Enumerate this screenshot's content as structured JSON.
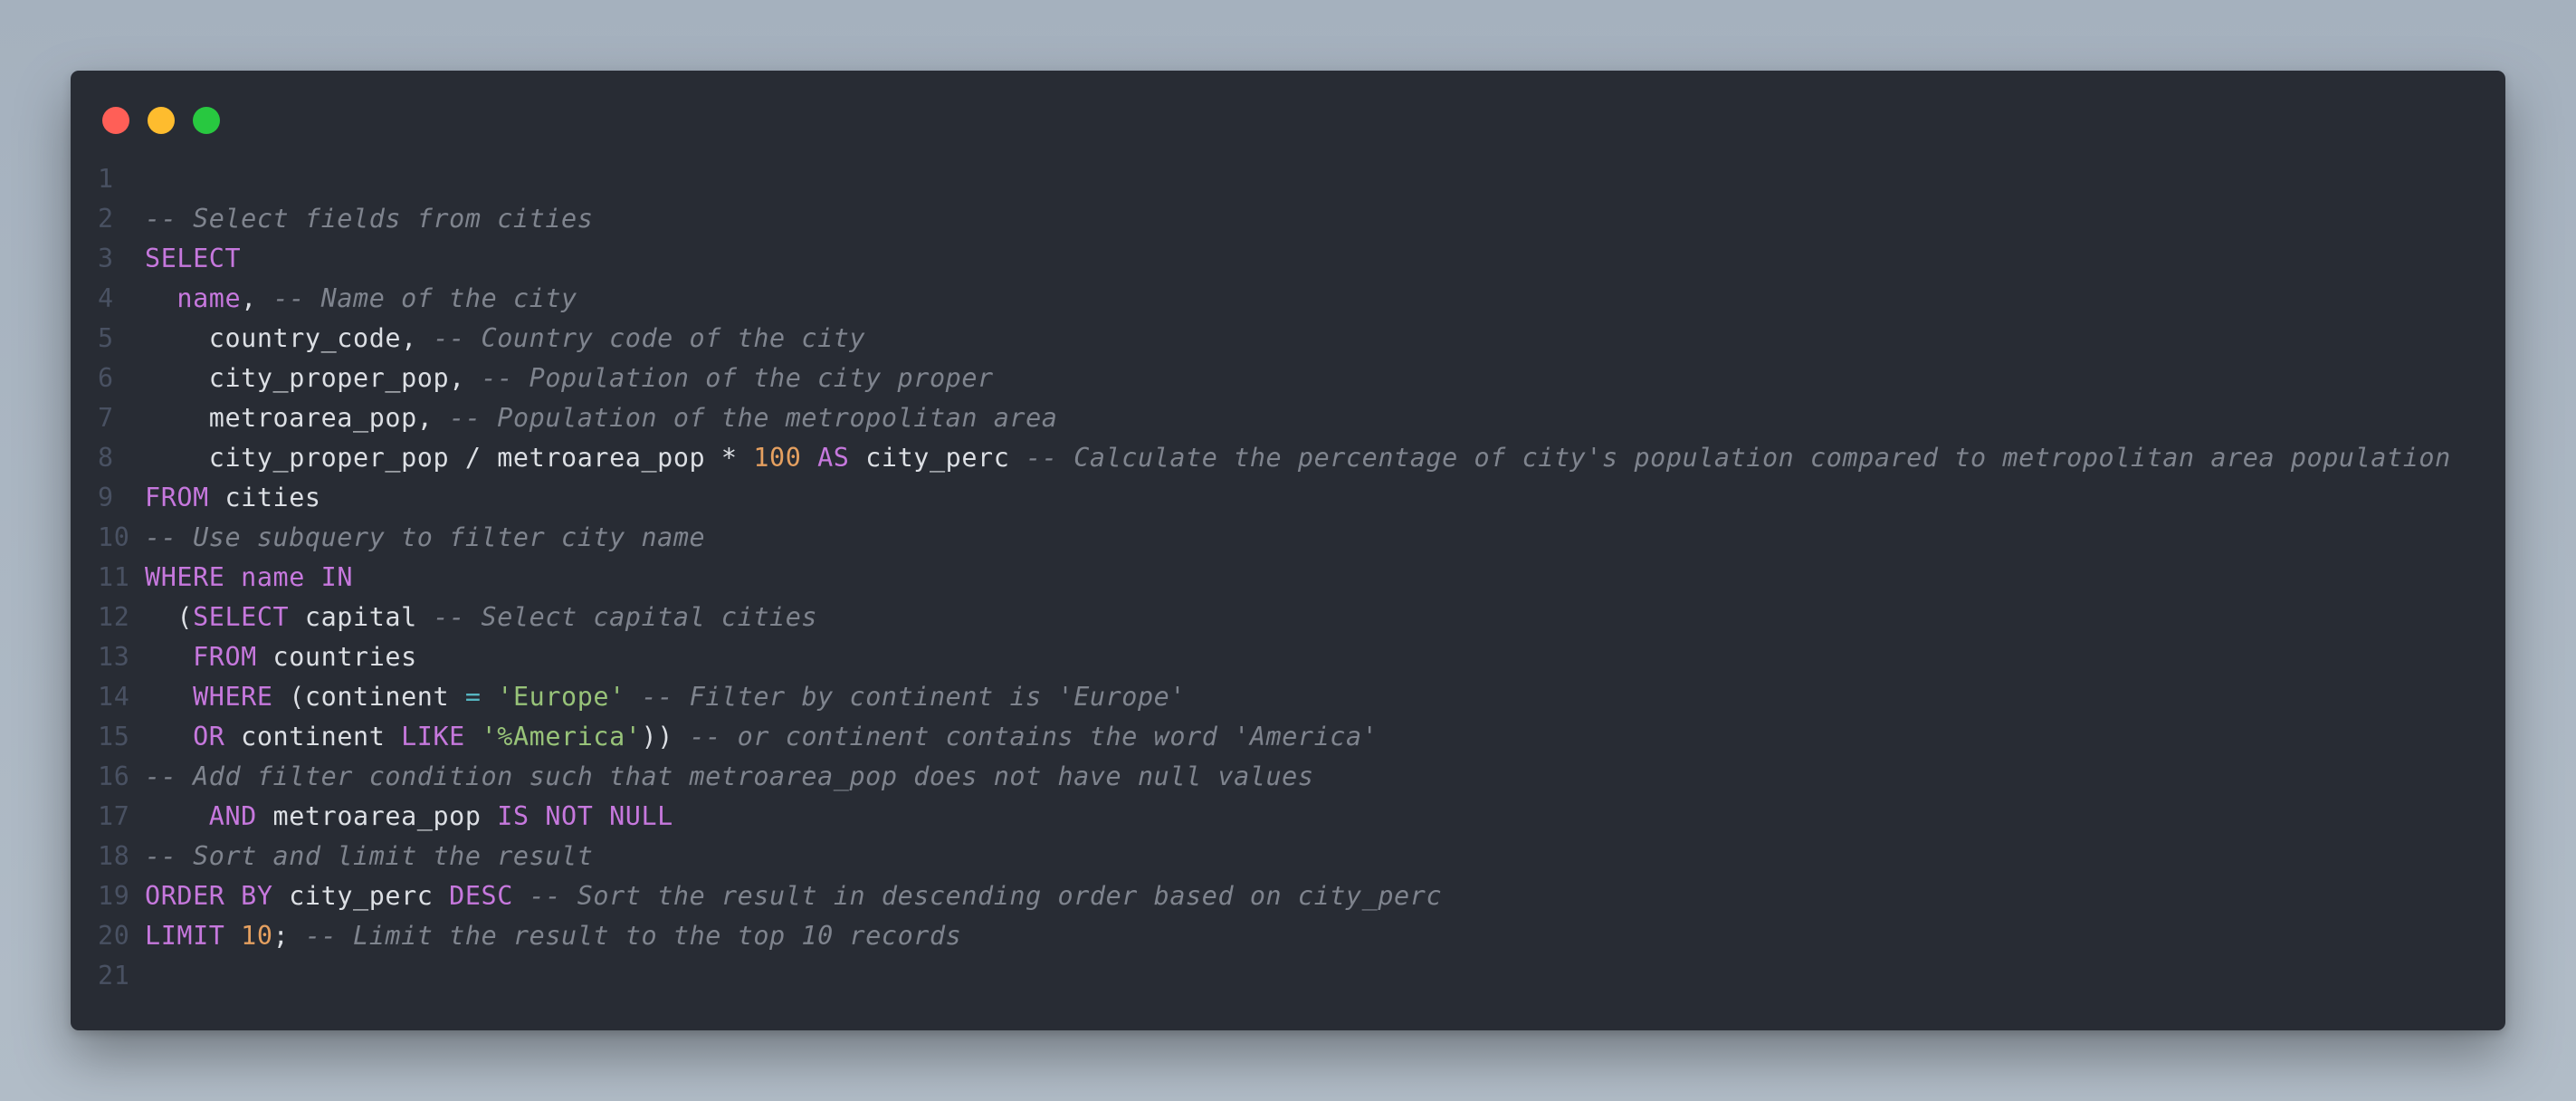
{
  "window": {
    "controls": [
      {
        "name": "close",
        "color": "#ff5f57"
      },
      {
        "name": "minimize",
        "color": "#febc2e"
      },
      {
        "name": "maximize",
        "color": "#28c840"
      }
    ]
  },
  "editor": {
    "language": "sql",
    "theme_colors": {
      "background": "#282c34",
      "keyword": "#c678dd",
      "comment": "#7f848e",
      "number": "#e5a060",
      "string": "#98c379",
      "operator": "#56b6c2",
      "identifier": "#dcdfe4",
      "line_number": "#495162"
    },
    "lines": [
      {
        "n": "1",
        "tokens": []
      },
      {
        "n": "2",
        "tokens": [
          [
            "cm",
            "-- Select fields from cities"
          ]
        ]
      },
      {
        "n": "3",
        "tokens": [
          [
            "kw",
            "SELECT"
          ]
        ]
      },
      {
        "n": "4",
        "tokens": [
          [
            "id",
            "  "
          ],
          [
            "kw",
            "name"
          ],
          [
            "id",
            ", "
          ],
          [
            "cm",
            "-- Name of the city"
          ]
        ]
      },
      {
        "n": "5",
        "tokens": [
          [
            "id",
            "    country_code, "
          ],
          [
            "cm",
            "-- Country code of the city"
          ]
        ]
      },
      {
        "n": "6",
        "tokens": [
          [
            "id",
            "    city_proper_pop, "
          ],
          [
            "cm",
            "-- Population of the city proper"
          ]
        ]
      },
      {
        "n": "7",
        "tokens": [
          [
            "id",
            "    metroarea_pop, "
          ],
          [
            "cm",
            "-- Population of the metropolitan area"
          ]
        ]
      },
      {
        "n": "8",
        "tokens": [
          [
            "id",
            "    city_proper_pop / metroarea_pop * "
          ],
          [
            "num",
            "100"
          ],
          [
            "id",
            " "
          ],
          [
            "kw",
            "AS"
          ],
          [
            "id",
            " city_perc "
          ],
          [
            "cm",
            "-- Calculate the percentage of city's population compared to metropolitan area population"
          ]
        ]
      },
      {
        "n": "9",
        "tokens": [
          [
            "kw",
            "FROM"
          ],
          [
            "id",
            " cities"
          ]
        ]
      },
      {
        "n": "10",
        "tokens": [
          [
            "cm",
            "-- Use subquery to filter city name"
          ]
        ]
      },
      {
        "n": "11",
        "tokens": [
          [
            "kw",
            "WHERE"
          ],
          [
            "id",
            " "
          ],
          [
            "kw",
            "name"
          ],
          [
            "id",
            " "
          ],
          [
            "kw",
            "IN"
          ]
        ]
      },
      {
        "n": "12",
        "tokens": [
          [
            "id",
            "  ("
          ],
          [
            "kw",
            "SELECT"
          ],
          [
            "id",
            " capital "
          ],
          [
            "cm",
            "-- Select capital cities"
          ]
        ]
      },
      {
        "n": "13",
        "tokens": [
          [
            "id",
            "   "
          ],
          [
            "kw",
            "FROM"
          ],
          [
            "id",
            " countries"
          ]
        ]
      },
      {
        "n": "14",
        "tokens": [
          [
            "id",
            "   "
          ],
          [
            "kw",
            "WHERE"
          ],
          [
            "id",
            " (continent "
          ],
          [
            "op",
            "="
          ],
          [
            "id",
            " "
          ],
          [
            "str",
            "'Europe'"
          ],
          [
            "id",
            " "
          ],
          [
            "cm",
            "-- Filter by continent is 'Europe'"
          ]
        ]
      },
      {
        "n": "15",
        "tokens": [
          [
            "id",
            "   "
          ],
          [
            "kw",
            "OR"
          ],
          [
            "id",
            " continent "
          ],
          [
            "kw",
            "LIKE"
          ],
          [
            "id",
            " "
          ],
          [
            "str",
            "'%America'"
          ],
          [
            "id",
            ")) "
          ],
          [
            "cm",
            "-- or continent contains the word 'America'"
          ]
        ]
      },
      {
        "n": "16",
        "tokens": [
          [
            "cm",
            "-- Add filter condition such that metroarea_pop does not have null values"
          ]
        ]
      },
      {
        "n": "17",
        "tokens": [
          [
            "id",
            "    "
          ],
          [
            "kw",
            "AND"
          ],
          [
            "id",
            " metroarea_pop "
          ],
          [
            "kw",
            "IS NOT NULL"
          ]
        ]
      },
      {
        "n": "18",
        "tokens": [
          [
            "cm",
            "-- Sort and limit the result"
          ]
        ]
      },
      {
        "n": "19",
        "tokens": [
          [
            "kw",
            "ORDER BY"
          ],
          [
            "id",
            " city_perc "
          ],
          [
            "kw",
            "DESC"
          ],
          [
            "id",
            " "
          ],
          [
            "cm",
            "-- Sort the result in descending order based on city_perc"
          ]
        ]
      },
      {
        "n": "20",
        "tokens": [
          [
            "kw",
            "LIMIT"
          ],
          [
            "id",
            " "
          ],
          [
            "num",
            "10"
          ],
          [
            "id",
            "; "
          ],
          [
            "cm",
            "-- Limit the result to the top 10 records"
          ]
        ]
      },
      {
        "n": "21",
        "tokens": []
      }
    ]
  }
}
